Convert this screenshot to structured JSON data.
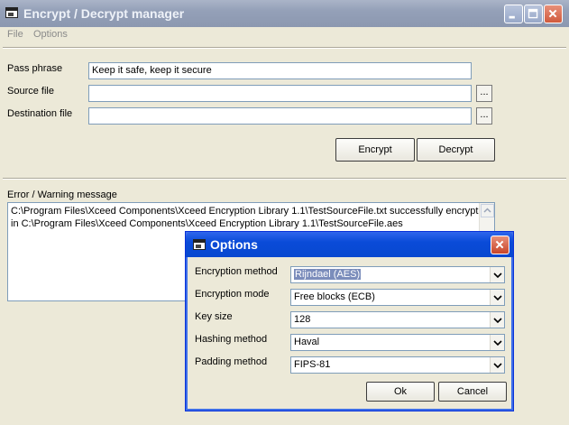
{
  "window": {
    "title": "Encrypt / Decrypt manager"
  },
  "menu": {
    "items": [
      "File",
      "Options"
    ]
  },
  "form": {
    "pass_phrase_label": "Pass phrase",
    "pass_phrase_value": "Keep it safe, keep it secure",
    "source_label": "Source file",
    "source_value": "",
    "dest_label": "Destination file",
    "dest_value": "",
    "browse_label": "...",
    "encrypt_label": "Encrypt",
    "decrypt_label": "Decrypt"
  },
  "messages": {
    "label": "Error / Warning message",
    "lines": [
      "C:\\Program Files\\Xceed Components\\Xceed Encryption Library 1.1\\TestSourceFile.txt successfully encrypted",
      "in C:\\Program Files\\Xceed Components\\Xceed Encryption Library 1.1\\TestSourceFile.aes"
    ]
  },
  "options_dialog": {
    "title": "Options",
    "fields": [
      {
        "label": "Encryption method",
        "value": "Rijndael (AES)"
      },
      {
        "label": "Encryption mode",
        "value": "Free blocks (ECB)"
      },
      {
        "label": "Key size",
        "value": "128"
      },
      {
        "label": "Hashing method",
        "value": "Haval"
      },
      {
        "label": "Padding method",
        "value": "FIPS-81"
      }
    ],
    "ok_label": "Ok",
    "cancel_label": "Cancel"
  },
  "icons": [
    "app-icon",
    "minimize-icon",
    "maximize-icon",
    "close-icon",
    "dropdown-arrow-icon"
  ],
  "colors": {
    "window_bg": "#ece9d8",
    "dialog_titlebar": "#0a4bd8",
    "inactive_titlebar": "#94a0b8",
    "selection": "#7b8dbb"
  }
}
